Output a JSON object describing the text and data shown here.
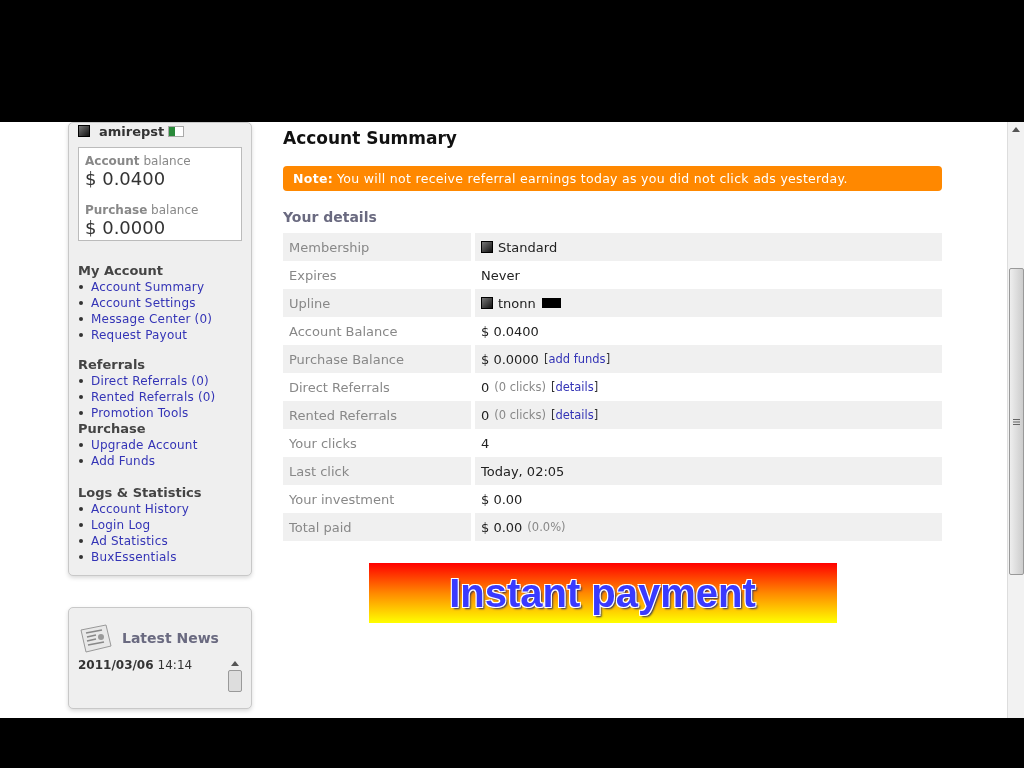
{
  "user": {
    "name": "amirepst"
  },
  "balances": [
    {
      "label": "**Account** balance",
      "value": "$ 0.0400"
    },
    {
      "label": "**Purchase** balance",
      "value": "$ 0.0000"
    }
  ],
  "menu": [
    {
      "title": "My Account",
      "items": [
        "Account Summary",
        "Account Settings",
        "Message Center (0)",
        "Request Payout"
      ]
    },
    {
      "title": "Referrals",
      "items": [
        "Direct Referrals (0)",
        "Rented Referrals (0)",
        "Promotion Tools"
      ]
    },
    {
      "title": "Purchase",
      "items": [
        "Upgrade Account",
        "Add Funds"
      ]
    },
    {
      "title": "**Logs** & **Statistics**",
      "items": [
        "Account History",
        "Login Log",
        "Ad Statistics",
        "BuxEssentials"
      ]
    }
  ],
  "news": {
    "title": "Latest News",
    "date": "2011/03/06",
    "time": "14:14"
  },
  "page_title": "Account Summary",
  "notice": {
    "label": "Note:",
    "text": "You will not receive referral earnings today as you did not click ads yesterday."
  },
  "details_title": "Your details",
  "details": [
    {
      "label": "Membership",
      "value": "Standard",
      "kind": "badge"
    },
    {
      "label": "Expires",
      "value": "Never",
      "kind": "text"
    },
    {
      "label": "Upline",
      "value": "tnonn",
      "kind": "user"
    },
    {
      "label": "Account Balance",
      "value": "$ 0.0400",
      "kind": "text"
    },
    {
      "label": "Purchase Balance",
      "value": "$ 0.0000",
      "kind": "text",
      "link": {
        "open": "[",
        "text": "add funds",
        "close": "]"
      }
    },
    {
      "label": "Direct Referrals",
      "value": "0",
      "kind": "text",
      "note": "(0 clicks)",
      "link": {
        "open": "[",
        "text": "details",
        "close": "]"
      }
    },
    {
      "label": "Rented Referrals",
      "value": "0",
      "kind": "text",
      "note": "(0 clicks)",
      "link": {
        "open": "[",
        "text": "details",
        "close": "]"
      }
    },
    {
      "label": "Your clicks",
      "value": "4",
      "kind": "text"
    },
    {
      "label": "Last click",
      "value": "Today, 02:05",
      "kind": "text"
    },
    {
      "label": "Your investment",
      "value": "$ 0.00",
      "kind": "text"
    },
    {
      "label": "Total paid",
      "value": "$ 0.00",
      "kind": "text",
      "note": "(0.0%)"
    }
  ],
  "banner": {
    "text": "Instant payment"
  }
}
